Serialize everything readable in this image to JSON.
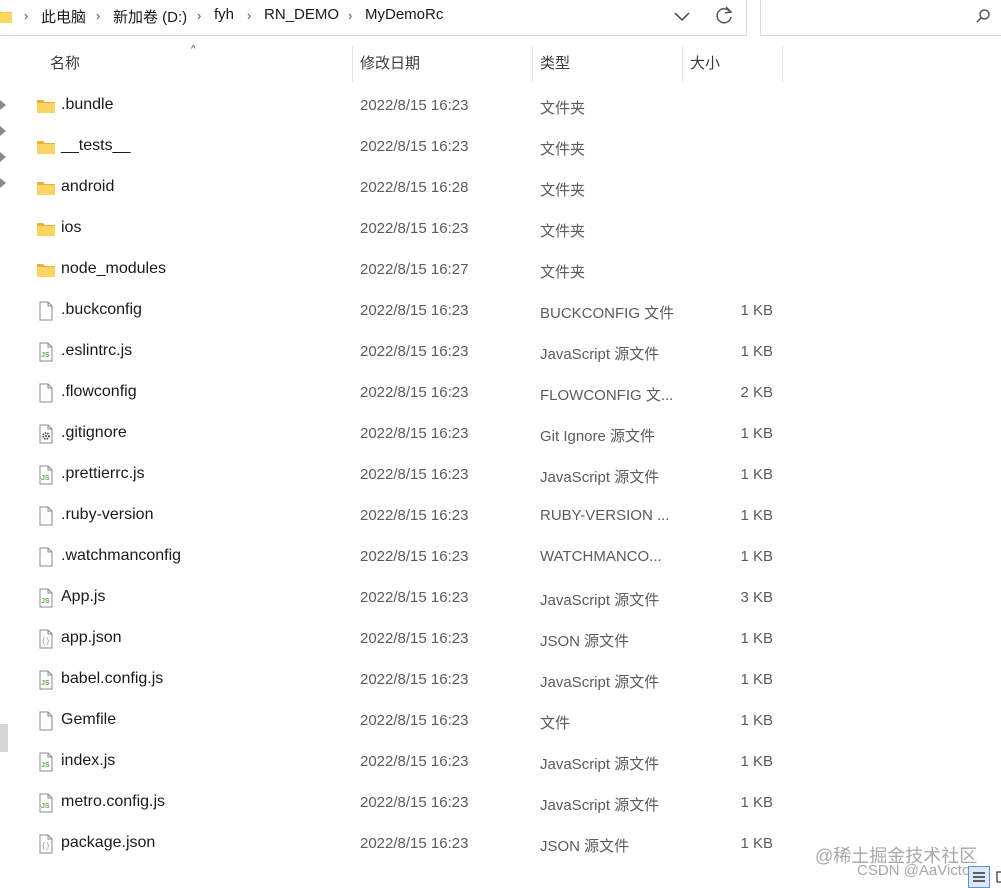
{
  "breadcrumb": [
    "此电脑",
    "新加卷 (D:)",
    "fyh",
    "RN_DEMO",
    "MyDemoRc"
  ],
  "columns": {
    "name": "名称",
    "date": "修改日期",
    "type": "类型",
    "size": "大小"
  },
  "files": [
    {
      "name": ".bundle",
      "date": "2022/8/15 16:23",
      "type": "文件夹",
      "size": "",
      "icon": "folder-icon"
    },
    {
      "name": "__tests__",
      "date": "2022/8/15 16:23",
      "type": "文件夹",
      "size": "",
      "icon": "folder-icon"
    },
    {
      "name": "android",
      "date": "2022/8/15 16:28",
      "type": "文件夹",
      "size": "",
      "icon": "folder-icon"
    },
    {
      "name": "ios",
      "date": "2022/8/15 16:23",
      "type": "文件夹",
      "size": "",
      "icon": "folder-icon"
    },
    {
      "name": "node_modules",
      "date": "2022/8/15 16:27",
      "type": "文件夹",
      "size": "",
      "icon": "folder-icon"
    },
    {
      "name": ".buckconfig",
      "date": "2022/8/15 16:23",
      "type": "BUCKCONFIG 文件",
      "size": "1 KB",
      "icon": "file-icon"
    },
    {
      "name": ".eslintrc.js",
      "date": "2022/8/15 16:23",
      "type": "JavaScript 源文件",
      "size": "1 KB",
      "icon": "js-file-icon"
    },
    {
      "name": ".flowconfig",
      "date": "2022/8/15 16:23",
      "type": "FLOWCONFIG 文...",
      "size": "2 KB",
      "icon": "file-icon"
    },
    {
      "name": ".gitignore",
      "date": "2022/8/15 16:23",
      "type": "Git Ignore 源文件",
      "size": "1 KB",
      "icon": "gear-file-icon"
    },
    {
      "name": ".prettierrc.js",
      "date": "2022/8/15 16:23",
      "type": "JavaScript 源文件",
      "size": "1 KB",
      "icon": "js-file-icon"
    },
    {
      "name": ".ruby-version",
      "date": "2022/8/15 16:23",
      "type": "RUBY-VERSION ...",
      "size": "1 KB",
      "icon": "file-icon"
    },
    {
      "name": ".watchmanconfig",
      "date": "2022/8/15 16:23",
      "type": "WATCHMANCO...",
      "size": "1 KB",
      "icon": "file-icon"
    },
    {
      "name": "App.js",
      "date": "2022/8/15 16:23",
      "type": "JavaScript 源文件",
      "size": "3 KB",
      "icon": "js-file-icon"
    },
    {
      "name": "app.json",
      "date": "2022/8/15 16:23",
      "type": "JSON 源文件",
      "size": "1 KB",
      "icon": "json-file-icon"
    },
    {
      "name": "babel.config.js",
      "date": "2022/8/15 16:23",
      "type": "JavaScript 源文件",
      "size": "1 KB",
      "icon": "js-file-icon"
    },
    {
      "name": "Gemfile",
      "date": "2022/8/15 16:23",
      "type": "文件",
      "size": "1 KB",
      "icon": "file-icon"
    },
    {
      "name": "index.js",
      "date": "2022/8/15 16:23",
      "type": "JavaScript 源文件",
      "size": "1 KB",
      "icon": "js-file-icon"
    },
    {
      "name": "metro.config.js",
      "date": "2022/8/15 16:23",
      "type": "JavaScript 源文件",
      "size": "1 KB",
      "icon": "js-file-icon"
    },
    {
      "name": "package.json",
      "date": "2022/8/15 16:23",
      "type": "JSON 源文件",
      "size": "1 KB",
      "icon": "json-file-icon"
    }
  ],
  "watermark": {
    "line1": "@稀土掘金技术社区",
    "line2": "CSDN @AaVictory."
  },
  "colors": {
    "folder": "#f5c342",
    "js_icon": "#6aa84f",
    "text_secondary": "#5b5b5b"
  }
}
